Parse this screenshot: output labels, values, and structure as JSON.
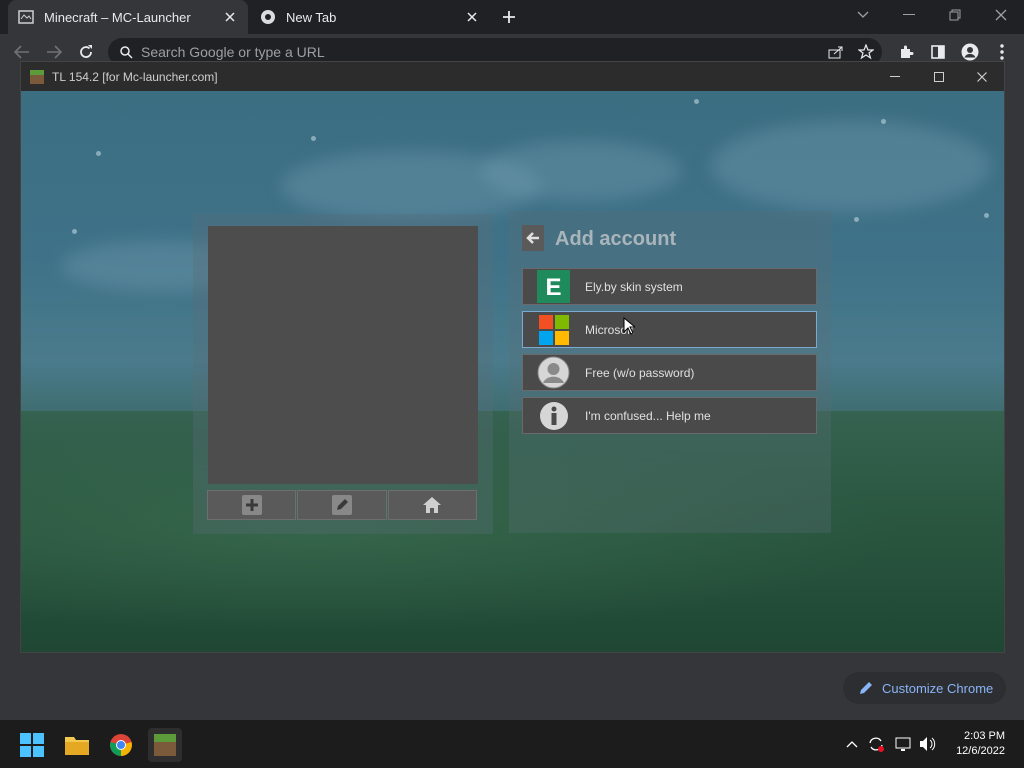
{
  "browser": {
    "tabs": [
      {
        "title": "Minecraft – MC-Launcher",
        "active": true
      },
      {
        "title": "New Tab",
        "active": false
      }
    ],
    "omnibox_placeholder": "Search Google or type a URL",
    "customize_label": "Customize Chrome"
  },
  "launcher": {
    "title": "TL 154.2 [for Mc-launcher.com]",
    "add_account_title": "Add account",
    "options": [
      {
        "label": "Ely.by skin system",
        "icon": "elyby-icon"
      },
      {
        "label": "Microsoft",
        "icon": "microsoft-icon"
      },
      {
        "label": "Free (w/o password)",
        "icon": "user-icon"
      },
      {
        "label": "I'm confused... Help me",
        "icon": "info-icon"
      }
    ],
    "left_buttons": [
      "plus-icon",
      "pencil-icon",
      "home-icon"
    ]
  },
  "taskbar": {
    "time": "2:03 PM",
    "date": "12/6/2022"
  },
  "colors": {
    "elyby": "#1f8a5b",
    "accent_blue": "#8ab4f8"
  }
}
